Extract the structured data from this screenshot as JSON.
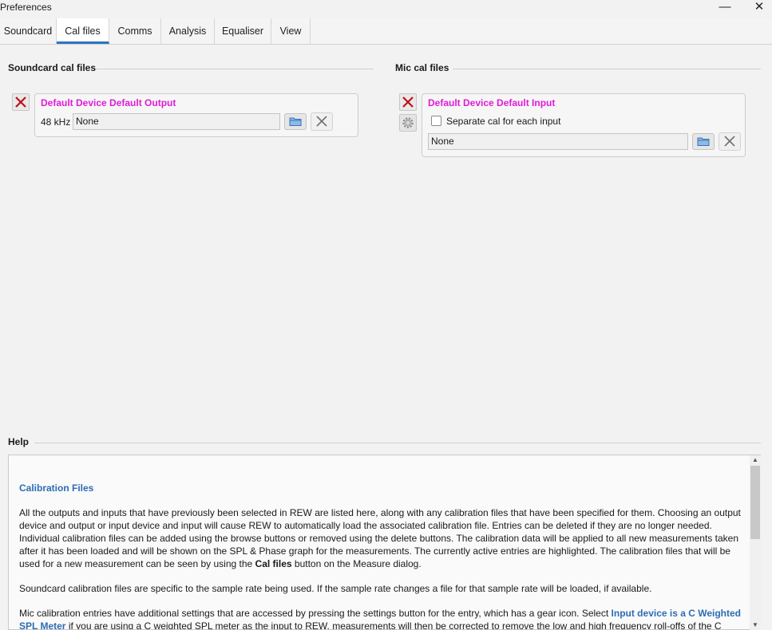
{
  "window": {
    "title": "Preferences",
    "minimize": "—",
    "close": "✕"
  },
  "tabs": [
    {
      "label": "Soundcard",
      "active": false
    },
    {
      "label": "Cal files",
      "active": true
    },
    {
      "label": "Comms",
      "active": false
    },
    {
      "label": "Analysis",
      "active": false
    },
    {
      "label": "Equaliser",
      "active": false
    },
    {
      "label": "View",
      "active": false
    }
  ],
  "soundcard_cal": {
    "title": "Soundcard cal files",
    "entry": {
      "device": "Default Device Default Output",
      "rate": "48 kHz",
      "file": "None"
    }
  },
  "mic_cal": {
    "title": "Mic cal files",
    "entry": {
      "device": "Default Device Default Input",
      "separate_label": "Separate cal for each input",
      "separate_checked": false,
      "file": "None"
    }
  },
  "help": {
    "title": "Help",
    "heading": "Calibration Files",
    "para1": "All the outputs and inputs that have previously been selected in REW are listed here, along with any calibration files that have been specified for them. Choosing an output device and output or input device and input will cause REW to automatically load the associated calibration file. Entries can be deleted if they are no longer needed. Individual calibration files can be added using the browse buttons or removed using the delete buttons. The calibration data will be applied to all new measurements taken after it has been loaded and will be shown on the SPL & Phase graph for the measurements. The currently active entries are highlighted. The calibration files that will be used for a new measurement can be seen by using the",
    "para1_bold": "Cal files",
    "para1_end": "button on the Measure dialog.",
    "para2": "Soundcard calibration files are specific to the sample rate being used. If the sample rate changes a file for that sample rate will be loaded, if available.",
    "para3_start": "Mic calibration entries have additional settings that are accessed by pressing the settings button for the entry, which has a gear icon. Select",
    "para3_link": "Input device is a C Weighted SPL Meter",
    "para3_end": "if you are using a C weighted SPL meter as the input to REW, measurements will then be corrected to remove the low and high frequency roll-offs of the C"
  },
  "colors": {
    "device_name": "#e01bd8",
    "accent": "#2d74c4",
    "link": "#2d6cb5",
    "delete_x": "#c0101a"
  },
  "icons": [
    "delete-icon",
    "gear-icon",
    "folder-icon",
    "clear-icon",
    "minimize-icon",
    "close-icon",
    "scroll-up-icon",
    "scroll-down-icon"
  ]
}
